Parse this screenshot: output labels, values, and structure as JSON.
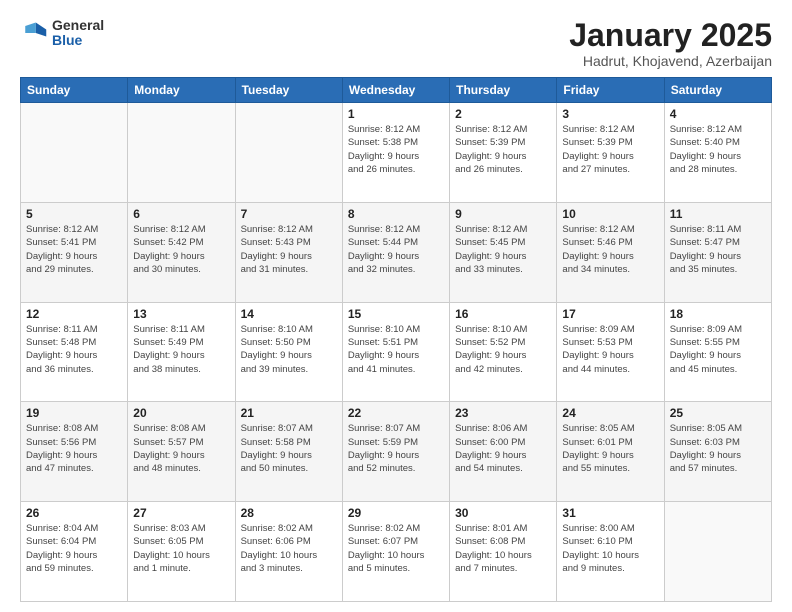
{
  "header": {
    "logo_general": "General",
    "logo_blue": "Blue",
    "title": "January 2025",
    "location": "Hadrut, Khojavend, Azerbaijan"
  },
  "days_of_week": [
    "Sunday",
    "Monday",
    "Tuesday",
    "Wednesday",
    "Thursday",
    "Friday",
    "Saturday"
  ],
  "weeks": [
    [
      {
        "day": "",
        "info": ""
      },
      {
        "day": "",
        "info": ""
      },
      {
        "day": "",
        "info": ""
      },
      {
        "day": "1",
        "info": "Sunrise: 8:12 AM\nSunset: 5:38 PM\nDaylight: 9 hours\nand 26 minutes."
      },
      {
        "day": "2",
        "info": "Sunrise: 8:12 AM\nSunset: 5:39 PM\nDaylight: 9 hours\nand 26 minutes."
      },
      {
        "day": "3",
        "info": "Sunrise: 8:12 AM\nSunset: 5:39 PM\nDaylight: 9 hours\nand 27 minutes."
      },
      {
        "day": "4",
        "info": "Sunrise: 8:12 AM\nSunset: 5:40 PM\nDaylight: 9 hours\nand 28 minutes."
      }
    ],
    [
      {
        "day": "5",
        "info": "Sunrise: 8:12 AM\nSunset: 5:41 PM\nDaylight: 9 hours\nand 29 minutes."
      },
      {
        "day": "6",
        "info": "Sunrise: 8:12 AM\nSunset: 5:42 PM\nDaylight: 9 hours\nand 30 minutes."
      },
      {
        "day": "7",
        "info": "Sunrise: 8:12 AM\nSunset: 5:43 PM\nDaylight: 9 hours\nand 31 minutes."
      },
      {
        "day": "8",
        "info": "Sunrise: 8:12 AM\nSunset: 5:44 PM\nDaylight: 9 hours\nand 32 minutes."
      },
      {
        "day": "9",
        "info": "Sunrise: 8:12 AM\nSunset: 5:45 PM\nDaylight: 9 hours\nand 33 minutes."
      },
      {
        "day": "10",
        "info": "Sunrise: 8:12 AM\nSunset: 5:46 PM\nDaylight: 9 hours\nand 34 minutes."
      },
      {
        "day": "11",
        "info": "Sunrise: 8:11 AM\nSunset: 5:47 PM\nDaylight: 9 hours\nand 35 minutes."
      }
    ],
    [
      {
        "day": "12",
        "info": "Sunrise: 8:11 AM\nSunset: 5:48 PM\nDaylight: 9 hours\nand 36 minutes."
      },
      {
        "day": "13",
        "info": "Sunrise: 8:11 AM\nSunset: 5:49 PM\nDaylight: 9 hours\nand 38 minutes."
      },
      {
        "day": "14",
        "info": "Sunrise: 8:10 AM\nSunset: 5:50 PM\nDaylight: 9 hours\nand 39 minutes."
      },
      {
        "day": "15",
        "info": "Sunrise: 8:10 AM\nSunset: 5:51 PM\nDaylight: 9 hours\nand 41 minutes."
      },
      {
        "day": "16",
        "info": "Sunrise: 8:10 AM\nSunset: 5:52 PM\nDaylight: 9 hours\nand 42 minutes."
      },
      {
        "day": "17",
        "info": "Sunrise: 8:09 AM\nSunset: 5:53 PM\nDaylight: 9 hours\nand 44 minutes."
      },
      {
        "day": "18",
        "info": "Sunrise: 8:09 AM\nSunset: 5:55 PM\nDaylight: 9 hours\nand 45 minutes."
      }
    ],
    [
      {
        "day": "19",
        "info": "Sunrise: 8:08 AM\nSunset: 5:56 PM\nDaylight: 9 hours\nand 47 minutes."
      },
      {
        "day": "20",
        "info": "Sunrise: 8:08 AM\nSunset: 5:57 PM\nDaylight: 9 hours\nand 48 minutes."
      },
      {
        "day": "21",
        "info": "Sunrise: 8:07 AM\nSunset: 5:58 PM\nDaylight: 9 hours\nand 50 minutes."
      },
      {
        "day": "22",
        "info": "Sunrise: 8:07 AM\nSunset: 5:59 PM\nDaylight: 9 hours\nand 52 minutes."
      },
      {
        "day": "23",
        "info": "Sunrise: 8:06 AM\nSunset: 6:00 PM\nDaylight: 9 hours\nand 54 minutes."
      },
      {
        "day": "24",
        "info": "Sunrise: 8:05 AM\nSunset: 6:01 PM\nDaylight: 9 hours\nand 55 minutes."
      },
      {
        "day": "25",
        "info": "Sunrise: 8:05 AM\nSunset: 6:03 PM\nDaylight: 9 hours\nand 57 minutes."
      }
    ],
    [
      {
        "day": "26",
        "info": "Sunrise: 8:04 AM\nSunset: 6:04 PM\nDaylight: 9 hours\nand 59 minutes."
      },
      {
        "day": "27",
        "info": "Sunrise: 8:03 AM\nSunset: 6:05 PM\nDaylight: 10 hours\nand 1 minute."
      },
      {
        "day": "28",
        "info": "Sunrise: 8:02 AM\nSunset: 6:06 PM\nDaylight: 10 hours\nand 3 minutes."
      },
      {
        "day": "29",
        "info": "Sunrise: 8:02 AM\nSunset: 6:07 PM\nDaylight: 10 hours\nand 5 minutes."
      },
      {
        "day": "30",
        "info": "Sunrise: 8:01 AM\nSunset: 6:08 PM\nDaylight: 10 hours\nand 7 minutes."
      },
      {
        "day": "31",
        "info": "Sunrise: 8:00 AM\nSunset: 6:10 PM\nDaylight: 10 hours\nand 9 minutes."
      },
      {
        "day": "",
        "info": ""
      }
    ]
  ]
}
